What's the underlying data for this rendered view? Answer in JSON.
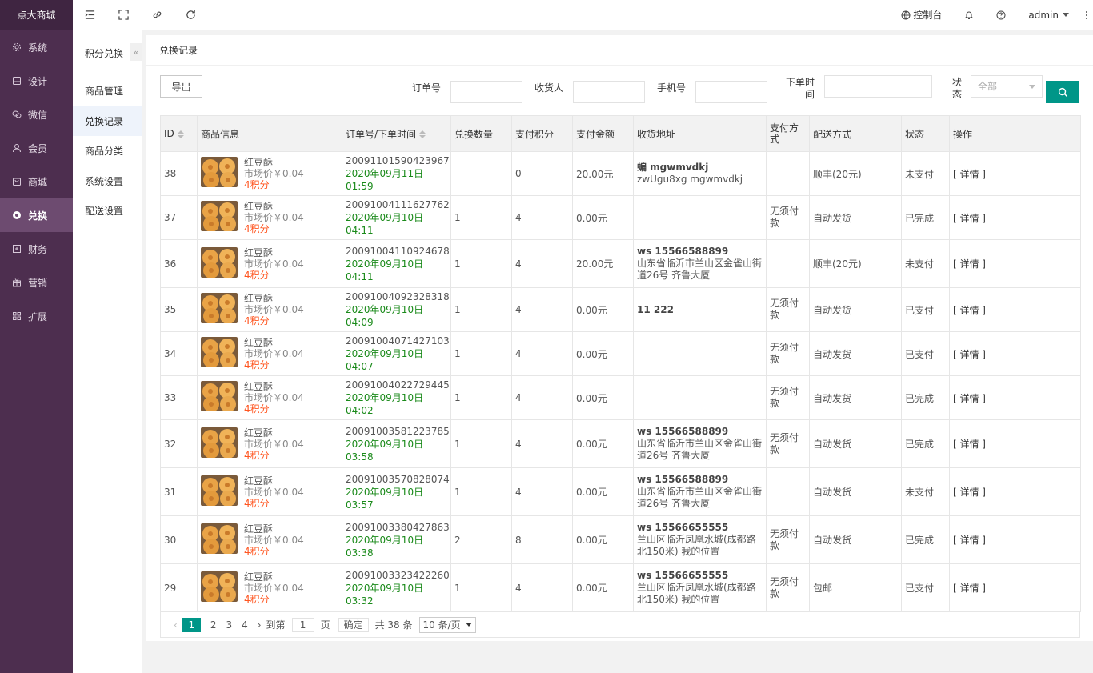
{
  "app": {
    "logo": "点大商城"
  },
  "sidebar": {
    "items": [
      {
        "label": "系统",
        "icon": "gear-icon"
      },
      {
        "label": "设计",
        "icon": "design-icon"
      },
      {
        "label": "微信",
        "icon": "wechat-icon"
      },
      {
        "label": "会员",
        "icon": "user-icon"
      },
      {
        "label": "商城",
        "icon": "shop-icon"
      },
      {
        "label": "兑换",
        "icon": "exchange-icon",
        "active": true
      },
      {
        "label": "财务",
        "icon": "finance-icon"
      },
      {
        "label": "营销",
        "icon": "gift-icon"
      },
      {
        "label": "扩展",
        "icon": "grid-icon"
      }
    ]
  },
  "topbar": {
    "console": "控制台",
    "user": "admin"
  },
  "subnav": {
    "title": "积分兑换",
    "collapse": "«",
    "items": [
      "商品管理",
      "兑换记录",
      "商品分类",
      "系统设置",
      "配送设置"
    ]
  },
  "page": {
    "title": "兑换记录"
  },
  "toolbar": {
    "export_label": "导出",
    "order_label": "订单号",
    "receiver_label": "收货人",
    "phone_label": "手机号",
    "time_label_1": "下单时",
    "time_label_2": "间",
    "status_label_1": "状",
    "status_label_2": "态",
    "status_value": "全部"
  },
  "table": {
    "headers": {
      "id": "ID",
      "goods": "商品信息",
      "order": "订单号/下单时间",
      "qty": "兑换数量",
      "points": "支付积分",
      "amount": "支付金额",
      "address": "收货地址",
      "pay": "支付方式",
      "ship": "配送方式",
      "status": "状态",
      "op": "操作"
    },
    "rows": [
      {
        "id": "38",
        "name": "红豆酥",
        "price": "市场价￥0.04",
        "points_text": "4积分",
        "order_no": "20091101590423967",
        "time": "2020年09月11日 01:59",
        "qty": "",
        "pay_points": "0",
        "amount": "20.00元",
        "addr_name": "蝙 mgwmvdkj",
        "addr": "zwUgu8xg mgwmvdkj",
        "pay_method": "",
        "ship": "顺丰(20元)",
        "status": "未支付",
        "status_color": "red",
        "op": "[ 详情 ]"
      },
      {
        "id": "37",
        "name": "红豆酥",
        "price": "市场价￥0.04",
        "points_text": "4积分",
        "order_no": "20091004111627762",
        "time": "2020年09月10日 04:11",
        "qty": "1",
        "pay_points": "4",
        "amount": "0.00元",
        "addr_name": "",
        "addr": "",
        "pay_method": "无须付款",
        "ship": "自动发货",
        "status": "已完成",
        "status_color": "grey",
        "op": "[ 详情 ]"
      },
      {
        "id": "36",
        "name": "红豆酥",
        "price": "市场价￥0.04",
        "points_text": "4积分",
        "order_no": "20091004110924678",
        "time": "2020年09月10日 04:11",
        "qty": "1",
        "pay_points": "4",
        "amount": "20.00元",
        "addr_name": "ws 15566588899",
        "addr": "山东省临沂市兰山区金雀山街道26号 齐鲁大厦",
        "pay_method": "",
        "ship": "顺丰(20元)",
        "status": "未支付",
        "status_color": "red",
        "op": "[ 详情 ]"
      },
      {
        "id": "35",
        "name": "红豆酥",
        "price": "市场价￥0.04",
        "points_text": "4积分",
        "order_no": "20091004092328318",
        "time": "2020年09月10日 04:09",
        "qty": "1",
        "pay_points": "4",
        "amount": "0.00元",
        "addr_name": "11 222",
        "addr": "",
        "pay_method": "无须付款",
        "ship": "自动发货",
        "status": "已支付",
        "status_color": "orange",
        "op": "[ 详情 ]"
      },
      {
        "id": "34",
        "name": "红豆酥",
        "price": "市场价￥0.04",
        "points_text": "4积分",
        "order_no": "20091004071427103",
        "time": "2020年09月10日 04:07",
        "qty": "1",
        "pay_points": "4",
        "amount": "0.00元",
        "addr_name": "",
        "addr": "",
        "pay_method": "无须付款",
        "ship": "自动发货",
        "status": "已支付",
        "status_color": "orange",
        "op": "[ 详情 ]"
      },
      {
        "id": "33",
        "name": "红豆酥",
        "price": "市场价￥0.04",
        "points_text": "4积分",
        "order_no": "20091004022729445",
        "time": "2020年09月10日 04:02",
        "qty": "1",
        "pay_points": "4",
        "amount": "0.00元",
        "addr_name": "",
        "addr": "",
        "pay_method": "无须付款",
        "ship": "自动发货",
        "status": "已完成",
        "status_color": "grey",
        "op": "[ 详情 ]"
      },
      {
        "id": "32",
        "name": "红豆酥",
        "price": "市场价￥0.04",
        "points_text": "4积分",
        "order_no": "20091003581223785",
        "time": "2020年09月10日 03:58",
        "qty": "1",
        "pay_points": "4",
        "amount": "0.00元",
        "addr_name": "ws 15566588899",
        "addr": "山东省临沂市兰山区金雀山街道26号 齐鲁大厦",
        "pay_method": "无须付款",
        "ship": "自动发货",
        "status": "已完成",
        "status_color": "grey",
        "op": "[ 详情 ]"
      },
      {
        "id": "31",
        "name": "红豆酥",
        "price": "市场价￥0.04",
        "points_text": "4积分",
        "order_no": "20091003570828074",
        "time": "2020年09月10日 03:57",
        "qty": "1",
        "pay_points": "4",
        "amount": "0.00元",
        "addr_name": "ws 15566588899",
        "addr": "山东省临沂市兰山区金雀山街道26号 齐鲁大厦",
        "pay_method": "",
        "ship": "自动发货",
        "status": "未支付",
        "status_color": "red",
        "op": "[ 详情 ]"
      },
      {
        "id": "30",
        "name": "红豆酥",
        "price": "市场价￥0.04",
        "points_text": "4积分",
        "order_no": "20091003380427863",
        "time": "2020年09月10日 03:38",
        "qty": "2",
        "pay_points": "8",
        "amount": "0.00元",
        "addr_name": "ws 15566655555",
        "addr": "兰山区临沂凤凰水城(成都路北150米) 我的位置",
        "pay_method": "无须付款",
        "ship": "自动发货",
        "status": "已完成",
        "status_color": "grey",
        "op": "[ 详情 ]"
      },
      {
        "id": "29",
        "name": "红豆酥",
        "price": "市场价￥0.04",
        "points_text": "4积分",
        "order_no": "20091003323422260",
        "time": "2020年09月10日 03:32",
        "qty": "1",
        "pay_points": "4",
        "amount": "0.00元",
        "addr_name": "ws 15566655555",
        "addr": "兰山区临沂凤凰水城(成都路北150米) 我的位置",
        "pay_method": "无须付款",
        "ship": "包邮",
        "status": "已支付",
        "status_color": "orange",
        "op": "[ 详情 ]"
      }
    ]
  },
  "pager": {
    "prev": "‹",
    "next": "›",
    "pages": [
      "1",
      "2",
      "3",
      "4"
    ],
    "current": "1",
    "goto_label": "到第",
    "goto_value": "1",
    "page_unit": "页",
    "confirm": "确定",
    "total": "共 38 条",
    "page_size": "10 条/页"
  }
}
